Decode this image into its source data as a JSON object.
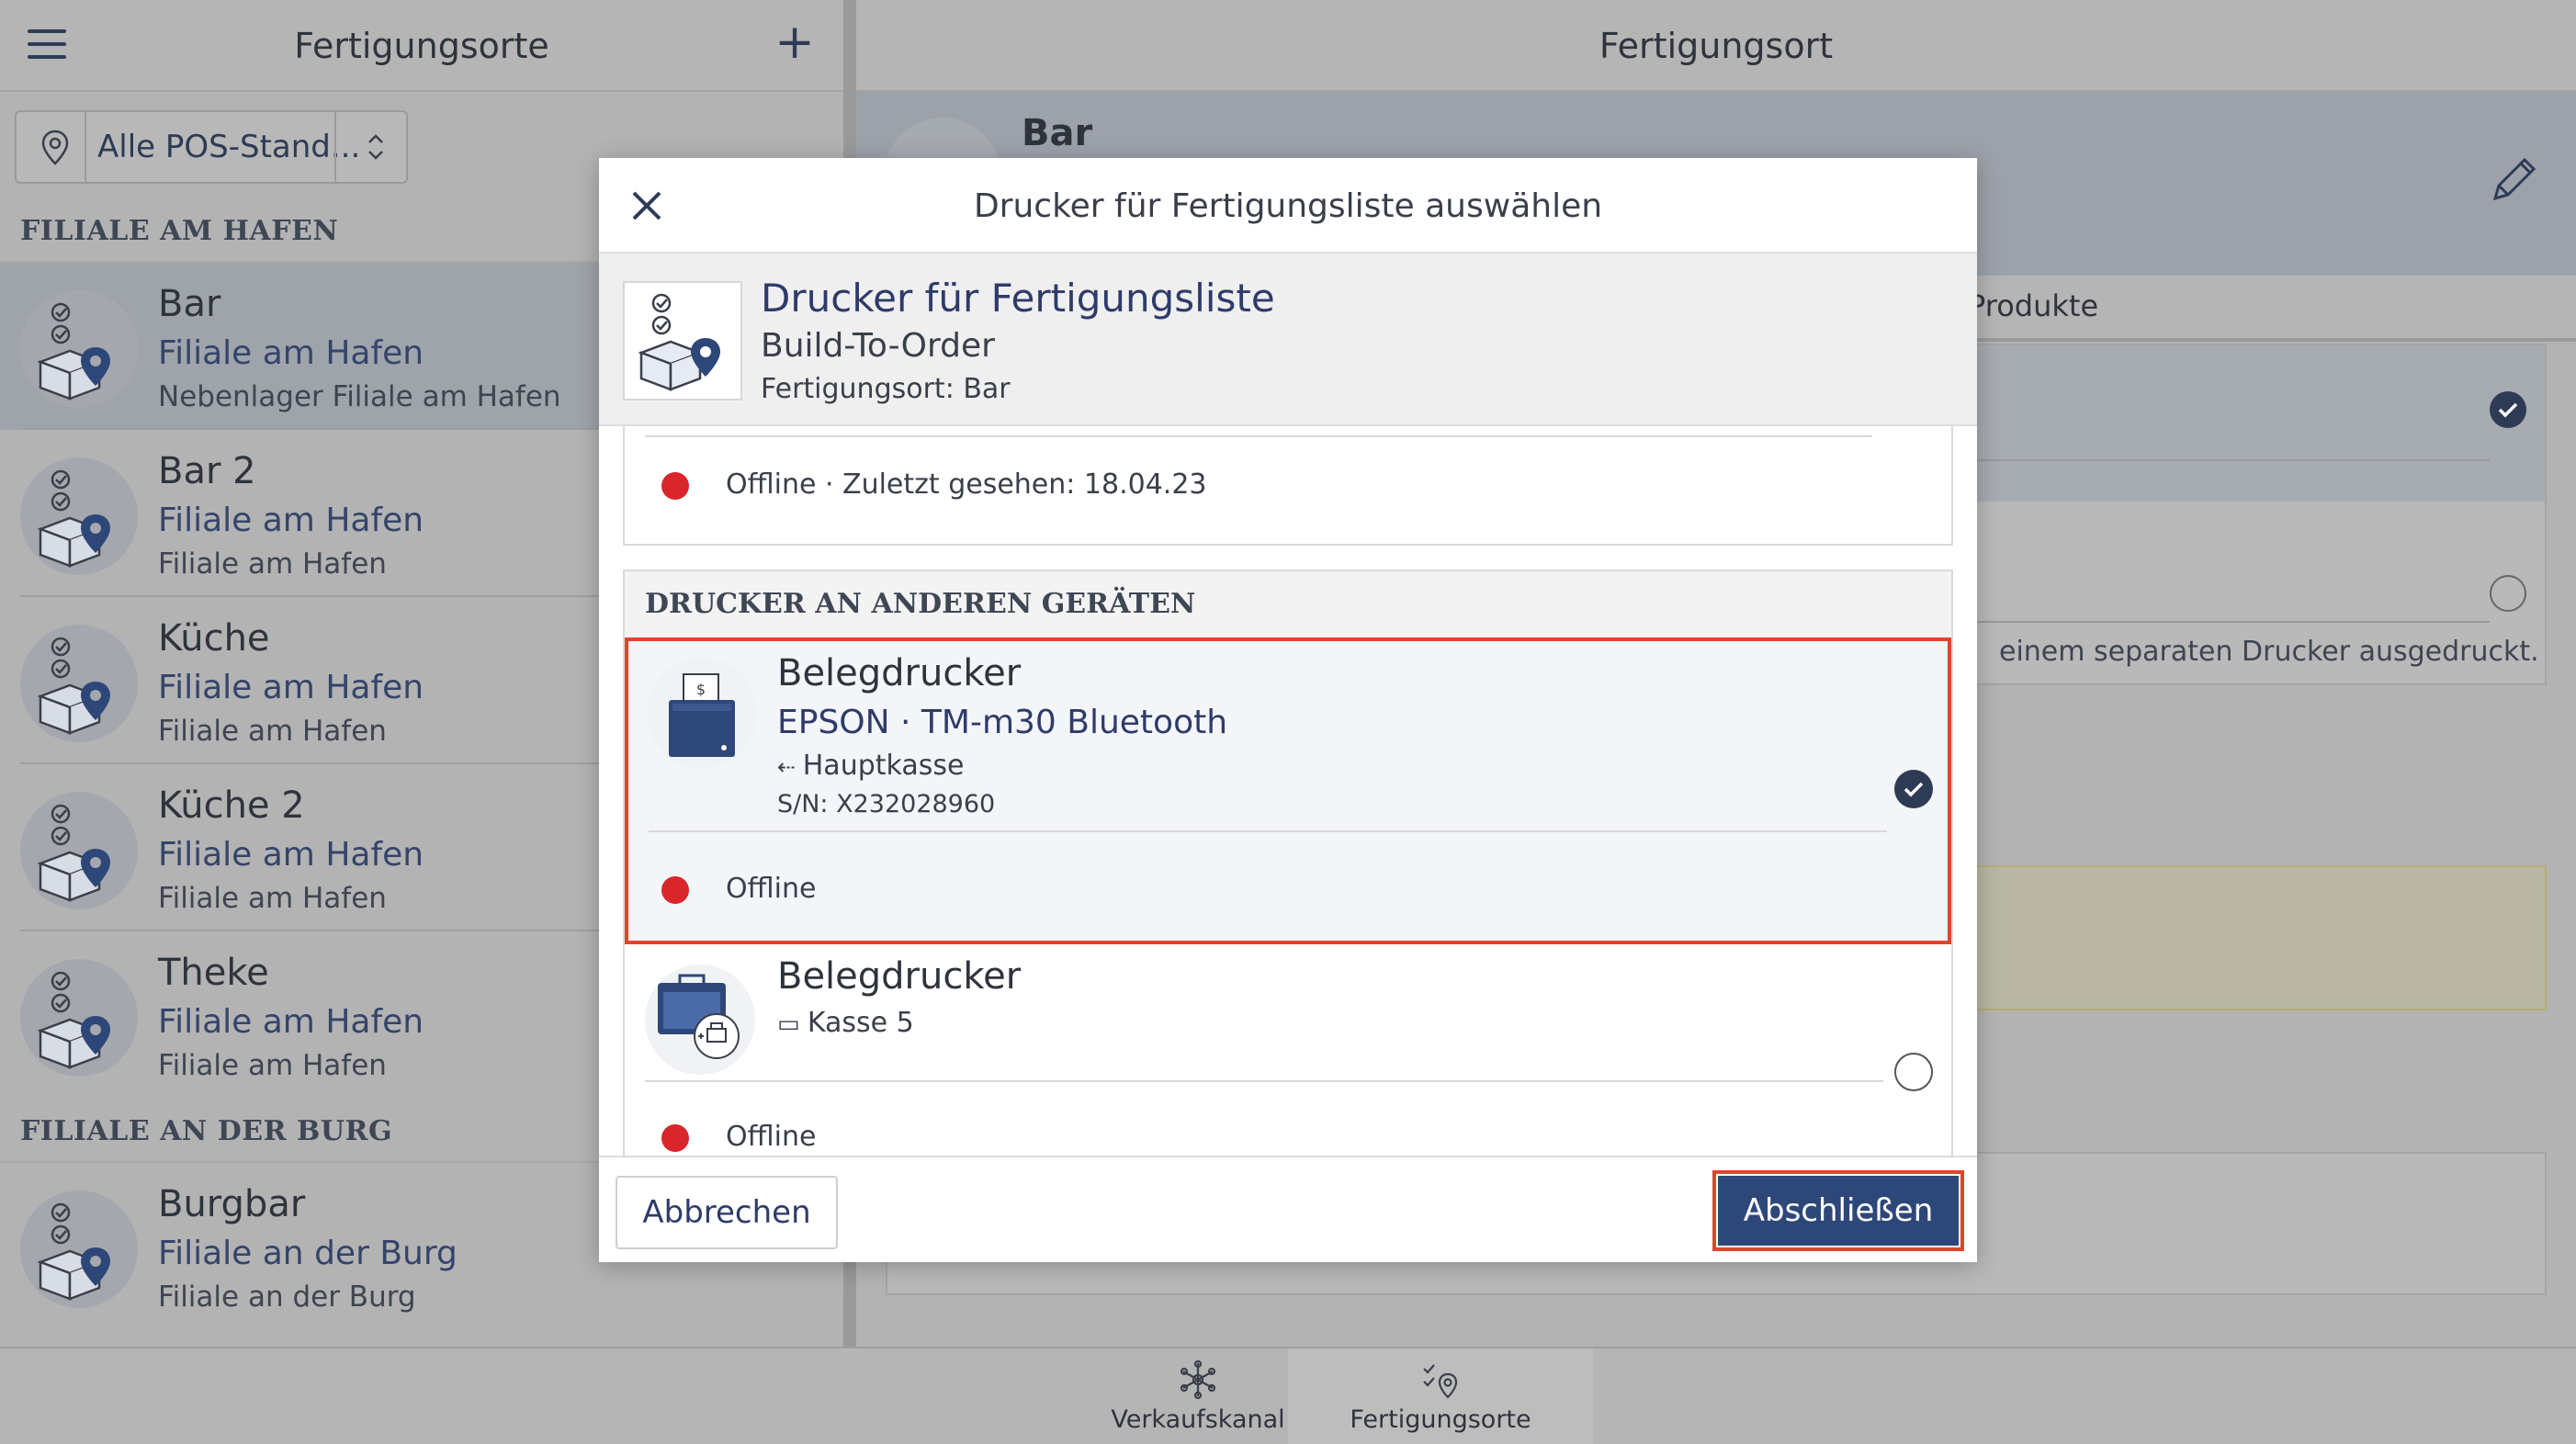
{
  "left": {
    "title": "Fertigungsorte",
    "filter_value": "Alle POS-Stand...",
    "sections": [
      {
        "label": "FILIALE AM HAFEN",
        "items": [
          {
            "name": "Bar",
            "sub1": "Filiale am Hafen",
            "sub2": "Nebenlager Filiale am Hafen"
          },
          {
            "name": "Bar 2",
            "sub1": "Filiale am Hafen",
            "sub2": "Filiale am Hafen"
          },
          {
            "name": "Küche",
            "sub1": "Filiale am Hafen",
            "sub2": "Filiale am Hafen"
          },
          {
            "name": "Küche 2",
            "sub1": "Filiale am Hafen",
            "sub2": "Filiale am Hafen"
          },
          {
            "name": "Theke",
            "sub1": "Filiale am Hafen",
            "sub2": "Filiale am Hafen"
          }
        ]
      },
      {
        "label": "FILIALE AN DER BURG",
        "items": [
          {
            "name": "Burgbar",
            "sub1": "Filiale an der Burg",
            "sub2": "Filiale an der Burg"
          }
        ]
      }
    ]
  },
  "right": {
    "title": "Fertigungsort",
    "detail_name": "Bar",
    "tab_products": "Produkte",
    "hint_text": "einem separaten Drucker ausgedruckt."
  },
  "bottom_nav": {
    "items": [
      {
        "label": "Verkaufskanal",
        "icon": "snowflake-icon"
      },
      {
        "label": "Fertigungsorte",
        "icon": "checklist-location-icon"
      }
    ]
  },
  "modal": {
    "title": "Drucker für Fertigungsliste auswählen",
    "header_title": "Drucker für Fertigungsliste",
    "header_line1": "Build-To-Order",
    "header_line2": "Fertigungsort: Bar",
    "prev_status": "Offline · Zuletzt gesehen: 18.04.23",
    "group_label": "DRUCKER AN ANDEREN GERÄTEN",
    "printers": [
      {
        "name": "Belegdrucker",
        "model": "EPSON · TM-m30 Bluetooth",
        "connection": "Hauptkasse",
        "serial": "S/N: X232028960",
        "status": "Offline",
        "selected": true
      },
      {
        "name": "Belegdrucker",
        "connection": "Kasse 5",
        "status": "Offline",
        "selected": false
      }
    ],
    "cancel_label": "Abbrechen",
    "confirm_label": "Abschließen"
  },
  "colors": {
    "accent": "#2e4779",
    "highlight": "#e0452c",
    "offline": "#d9262b",
    "navy": "#2e3b55"
  }
}
